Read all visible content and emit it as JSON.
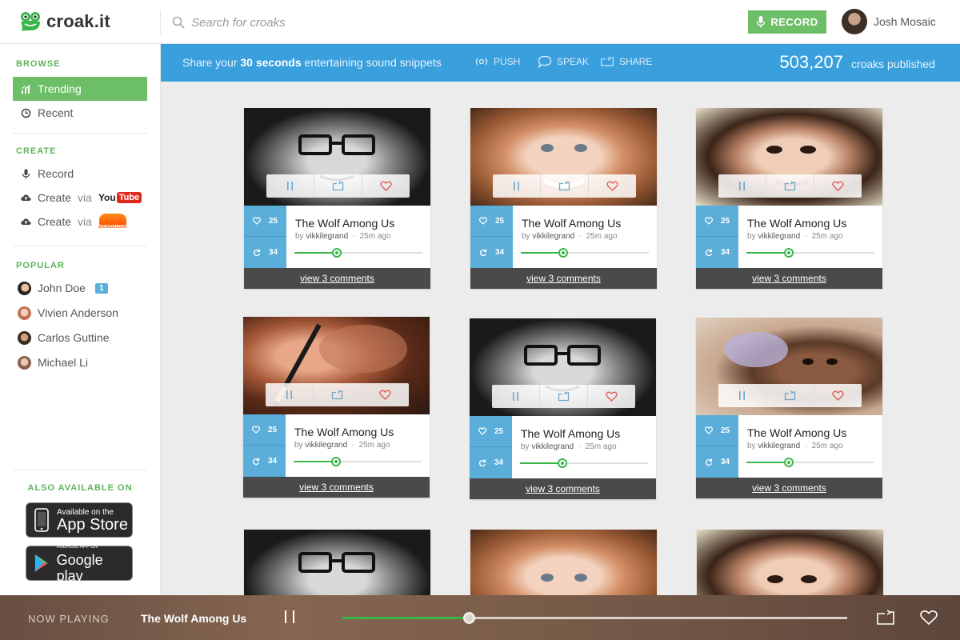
{
  "header": {
    "logo_text": "croak.it",
    "search_placeholder": "Search for croaks",
    "record_label": "RECORD",
    "user_name": "Josh Mosaic"
  },
  "sidebar": {
    "browse_title": "BROWSE",
    "browse_items": [
      {
        "label": "Trending",
        "icon": "trending-icon",
        "active": true
      },
      {
        "label": "Recent",
        "icon": "history-icon",
        "active": false
      }
    ],
    "create_title": "CREATE",
    "create_items": [
      {
        "label": "Record",
        "icon": "microphone-icon"
      },
      {
        "label": "Create",
        "via": "via",
        "service": "YouTube",
        "icon": "cloud-upload-icon"
      },
      {
        "label": "Create",
        "via": "via",
        "service": "SoundCloud",
        "icon": "cloud-upload-icon"
      }
    ],
    "popular_title": "POPULAR",
    "popular_items": [
      {
        "name": "John Doe",
        "badge": "1"
      },
      {
        "name": "Vivien Anderson"
      },
      {
        "name": "Carlos Guttine"
      },
      {
        "name": "Michael Li"
      }
    ],
    "also_title": "ALSO AVAILABLE ON",
    "app_store": {
      "small": "Available on the",
      "big": "App Store"
    },
    "google_play": {
      "small": "ANDROID APP ON",
      "big": "Google play"
    }
  },
  "banner": {
    "tagline_pre": "Share your",
    "tagline_bold": "30 seconds",
    "tagline_post": "entertaining sound snippets",
    "actions": [
      "PUSH",
      "SPEAK",
      "SHARE"
    ],
    "count": "503,207",
    "count_label": "croaks published"
  },
  "cards": [
    {
      "title": "The Wolf Among Us",
      "by": "by",
      "user": "vikkilegrand",
      "time": "25m ago",
      "likes": "25",
      "reposts": "34",
      "comments": "view 3 comments",
      "progress": 0.33
    },
    {
      "title": "The Wolf Among Us",
      "by": "by",
      "user": "vikkilegrand",
      "time": "25m ago",
      "likes": "25",
      "reposts": "34",
      "comments": "view 3 comments",
      "progress": 0.33
    },
    {
      "title": "The Wolf Among Us",
      "by": "by",
      "user": "vikkilegrand",
      "time": "25m ago",
      "likes": "25",
      "reposts": "34",
      "comments": "view 3 comments",
      "progress": 0.33
    },
    {
      "title": "The Wolf Among Us",
      "by": "by",
      "user": "vikkilegrand",
      "time": "25m ago",
      "likes": "25",
      "reposts": "34",
      "comments": "view 3 comments",
      "progress": 0.33
    },
    {
      "title": "The Wolf Among Us",
      "by": "by",
      "user": "vikkilegrand",
      "time": "25m ago",
      "likes": "25",
      "reposts": "34",
      "comments": "view 3 comments",
      "progress": 0.33
    },
    {
      "title": "The Wolf Among Us",
      "by": "by",
      "user": "vikkilegrand",
      "time": "25m ago",
      "likes": "25",
      "reposts": "34",
      "comments": "view 3 comments",
      "progress": 0.33
    }
  ],
  "player": {
    "now_playing_label": "NOW PLAYING",
    "title": "The Wolf Among Us",
    "progress": 0.25
  },
  "colors": {
    "accent_green": "#6dbf67",
    "banner_blue": "#3a9fdd",
    "stats_blue": "#5aaed9",
    "comments_dark": "#4a4a4a"
  }
}
